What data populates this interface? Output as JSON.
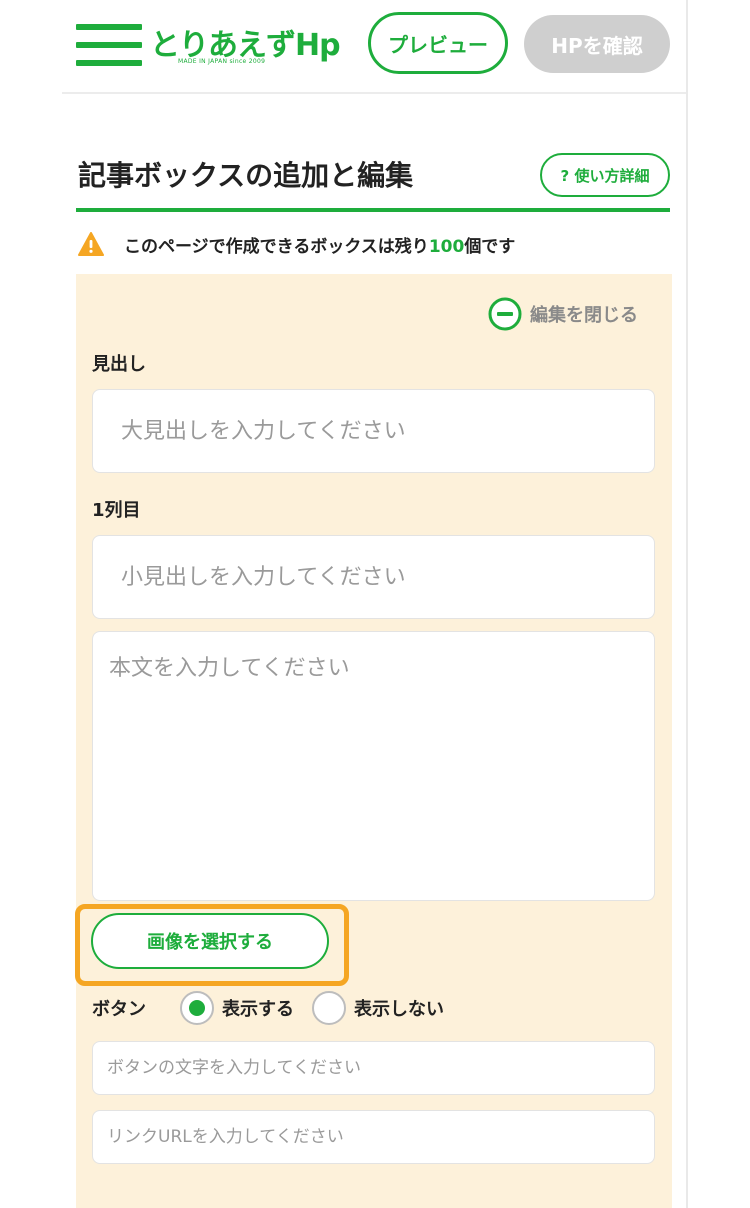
{
  "header": {
    "logo_text": "とりあえずHp",
    "logo_sub": "MADE IN JAPAN since 2009",
    "preview_label": "プレビュー",
    "hp_check_label": "HPを確認"
  },
  "page": {
    "title": "記事ボックスの追加と編集",
    "help_label": "? 使い方詳細",
    "warning": {
      "prefix": "このページで作成できるボックスは残り",
      "count": "100",
      "suffix": "個です"
    }
  },
  "editor": {
    "close_label": "編集を閉じる",
    "heading_label": "見出し",
    "heading_placeholder": "大見出しを入力してください",
    "column1_label": "1列目",
    "subheading_placeholder": "小見出しを入力してください",
    "body_placeholder": "本文を入力してください",
    "select_image_label": "画像を選択する",
    "button_section": {
      "label": "ボタン",
      "options": [
        "表示する",
        "表示しない"
      ],
      "selected": "表示する"
    },
    "button_text_placeholder": "ボタンの文字を入力してください",
    "link_url_placeholder": "リンクURLを入力してください"
  },
  "colors": {
    "accent": "#1ead3c",
    "panel_bg": "#fdf1da",
    "focus_outline": "#f5a623",
    "disabled_button": "#cfcfcf",
    "warning_icon": "#f5a623"
  },
  "icons": {
    "menu": "hamburger-icon",
    "warning": "warning-icon",
    "close": "minus-circle-icon"
  }
}
